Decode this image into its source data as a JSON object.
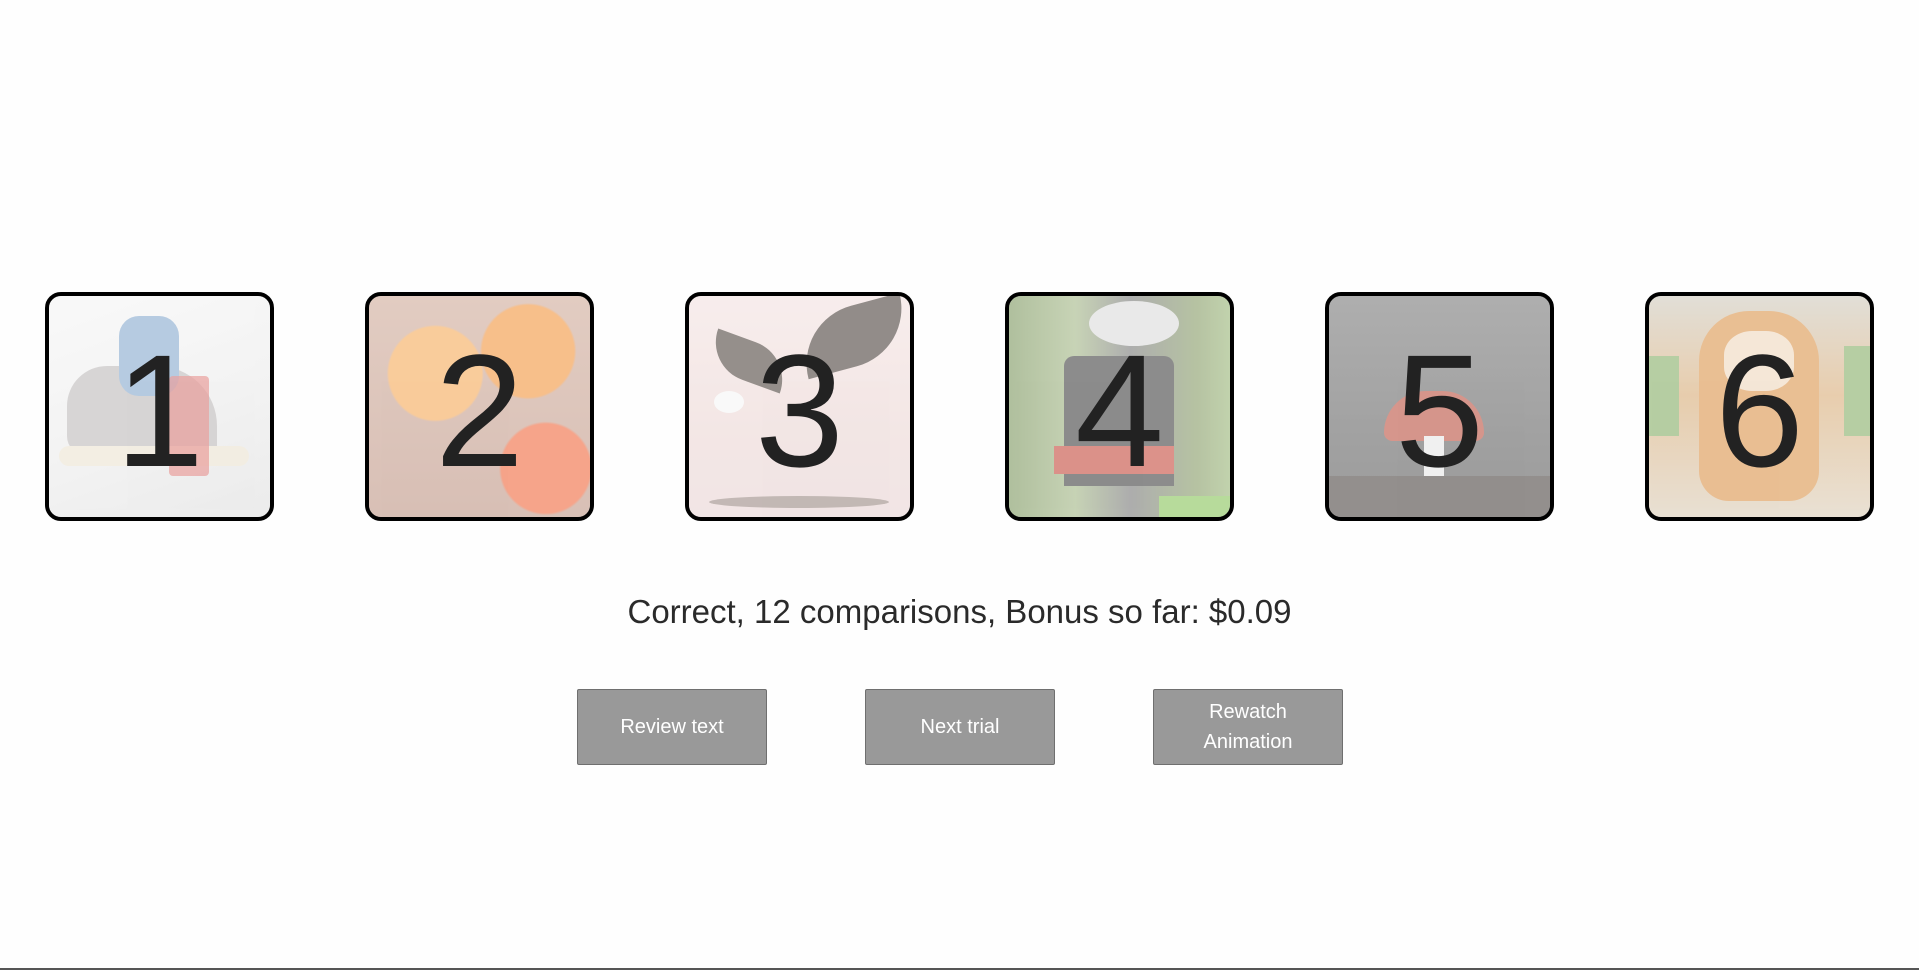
{
  "cards": [
    {
      "number": "1",
      "image": "sneakers"
    },
    {
      "number": "2",
      "image": "oranges-and-flower"
    },
    {
      "number": "3",
      "image": "eagle"
    },
    {
      "number": "4",
      "image": "steam-train"
    },
    {
      "number": "5",
      "image": "mushroom"
    },
    {
      "number": "6",
      "image": "tiger"
    }
  ],
  "status": {
    "text": "Correct, 12 comparisons, Bonus so far: $0.09"
  },
  "buttons": {
    "review_text": "Review text",
    "next_trial": "Next trial",
    "rewatch_animation": "Rewatch Animation"
  },
  "colors": {
    "button_bg": "#999999",
    "card_border": "#000000",
    "number_color": "#222222"
  }
}
